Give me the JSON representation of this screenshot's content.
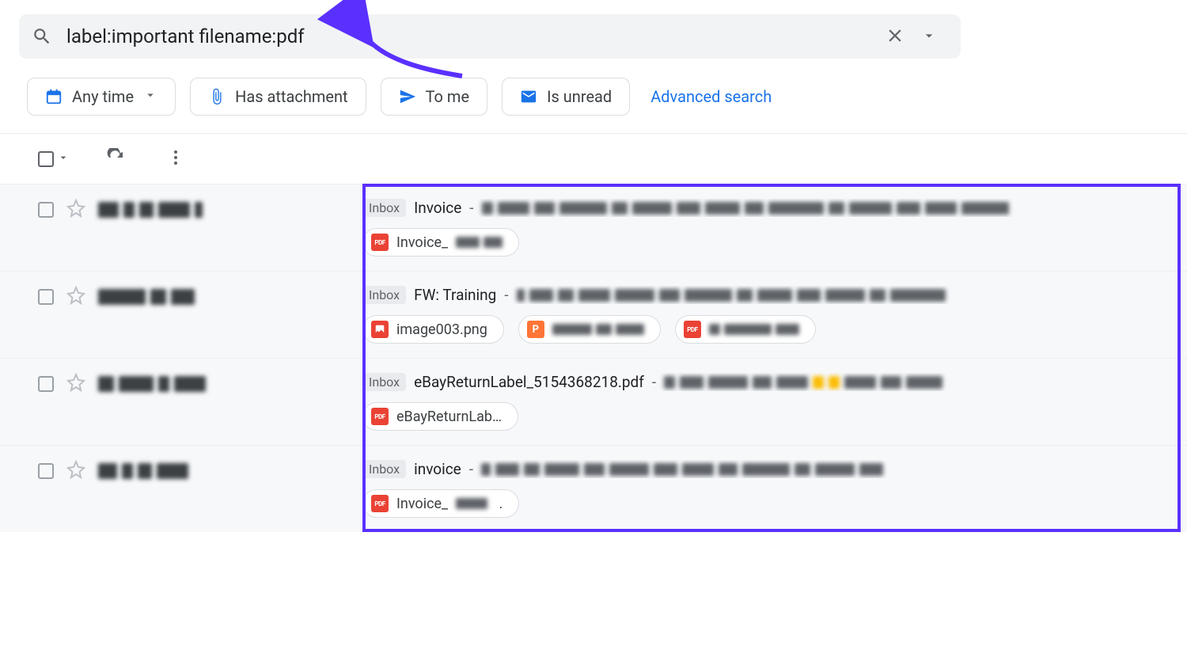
{
  "search": {
    "query": "label:important filename:pdf"
  },
  "filters": {
    "any_time": "Any time",
    "has_attachment": "Has attachment",
    "to_me": "To me",
    "is_unread": "Is unread",
    "advanced": "Advanced search"
  },
  "label_inbox": "Inbox",
  "rows": [
    {
      "subject": "Invoice",
      "attachments": [
        {
          "type": "pdf",
          "name_prefix": "Invoice_",
          "name_blurred": true
        }
      ]
    },
    {
      "subject": "FW: Training",
      "attachments": [
        {
          "type": "img",
          "name": "image003.png"
        },
        {
          "type": "ppt",
          "name_blurred": true
        },
        {
          "type": "pdf",
          "name_blurred": true
        }
      ]
    },
    {
      "subject": "eBayReturnLabel_5154368218.pdf",
      "attachments": [
        {
          "type": "pdf",
          "name": "eBayReturnLab…"
        }
      ]
    },
    {
      "subject": "invoice",
      "attachments": [
        {
          "type": "pdf",
          "name_prefix": "Invoice_",
          "name_blurred": true,
          "trailing_dot": true
        }
      ]
    }
  ]
}
